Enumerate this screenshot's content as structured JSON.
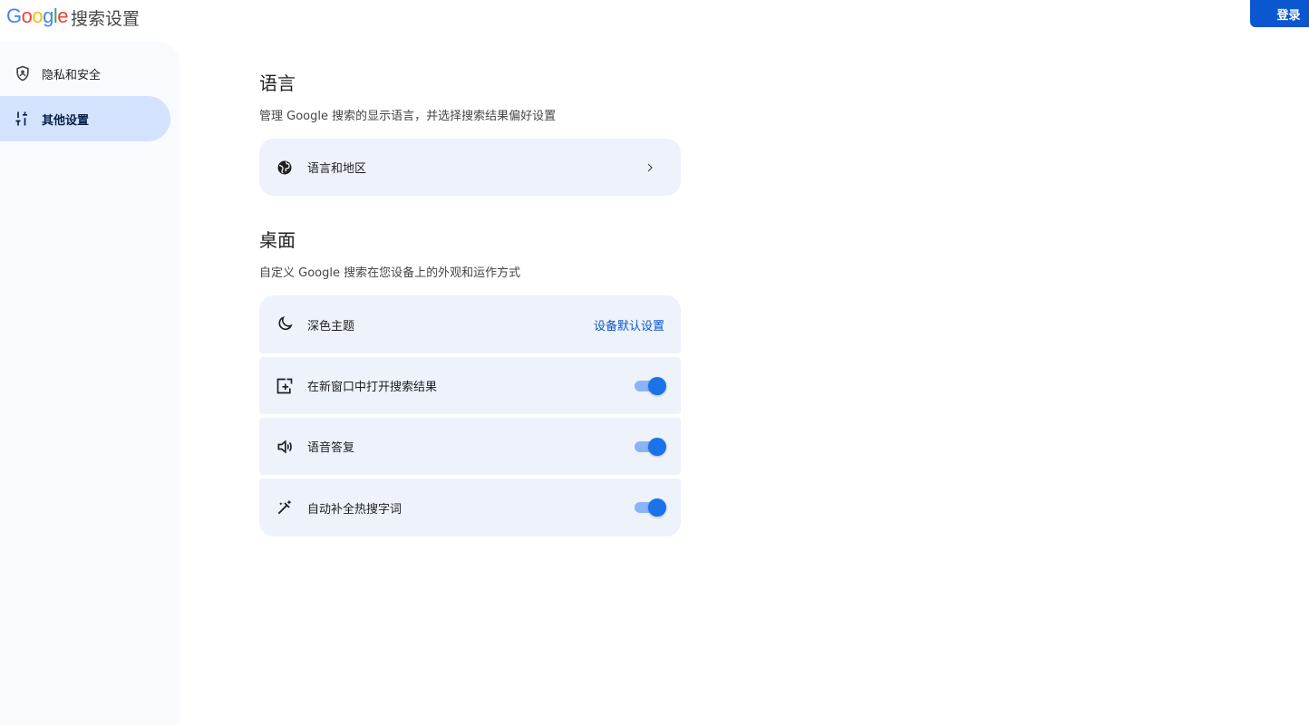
{
  "header": {
    "logo": [
      "G",
      "o",
      "o",
      "g",
      "l",
      "e"
    ],
    "title": "搜索设置",
    "signin_label": "登录"
  },
  "sidebar": {
    "items": [
      {
        "label": "隐私和安全",
        "icon": "shield-icon",
        "active": false
      },
      {
        "label": "其他设置",
        "icon": "sliders-icon",
        "active": true
      }
    ]
  },
  "sections": [
    {
      "title": "语言",
      "description": "管理 Google 搜索的显示语言，并选择搜索结果偏好设置",
      "items": [
        {
          "label": "语言和地区",
          "icon": "globe-icon",
          "control": "chevron"
        }
      ]
    },
    {
      "title": "桌面",
      "description": "自定义 Google 搜索在您设备上的外观和运作方式",
      "items": [
        {
          "label": "深色主题",
          "icon": "moon-icon",
          "control": "text",
          "value": "设备默认设置"
        },
        {
          "label": "在新窗口中打开搜索结果",
          "icon": "new-window-icon",
          "control": "toggle",
          "checked": true
        },
        {
          "label": "语音答复",
          "icon": "speaker-icon",
          "control": "toggle",
          "checked": true
        },
        {
          "label": "自动补全热搜字词",
          "icon": "magic-wand-icon",
          "control": "toggle",
          "checked": true
        }
      ]
    }
  ],
  "colors": {
    "accent": "#0b57d0",
    "card_bg": "#edf2fb",
    "active_nav": "#d3e3fd",
    "toggle_on": "#1a73e8"
  }
}
